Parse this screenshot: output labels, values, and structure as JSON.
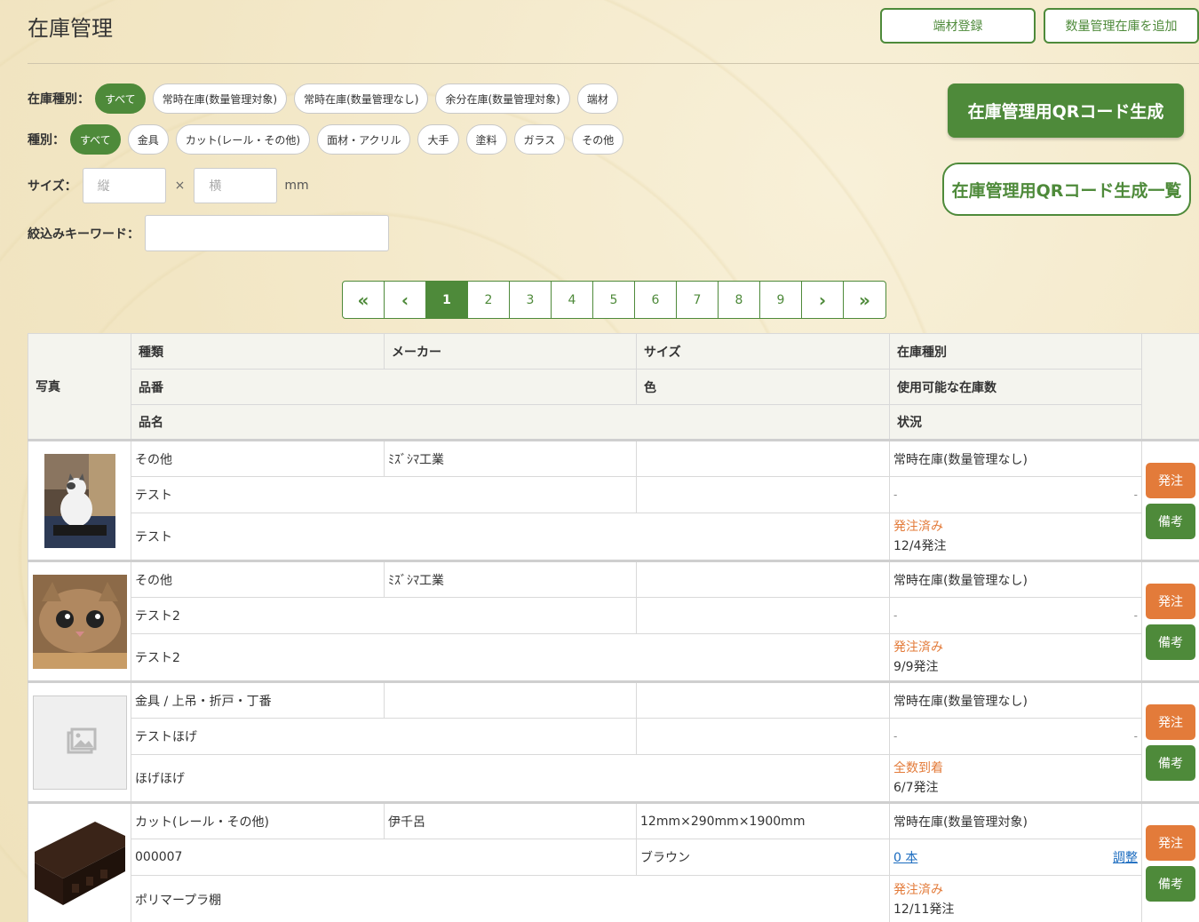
{
  "header": {
    "title": "在庫管理",
    "btn_scrap": "端材登録",
    "btn_add_qty": "数量管理在庫を追加"
  },
  "filters": {
    "stock_type_label": "在庫種別：",
    "stock_types": [
      "すべて",
      "常時在庫(数量管理対象)",
      "常時在庫(数量管理なし)",
      "余分在庫(数量管理対象)",
      "端材"
    ],
    "kind_label": "種別：",
    "kinds": [
      "すべて",
      "金具",
      "カット(レール・その他)",
      "面材・アクリル",
      "大手",
      "塗料",
      "ガラス",
      "その他"
    ],
    "size_label": "サイズ：",
    "size_h_placeholder": "縦",
    "size_times": "×",
    "size_w_placeholder": "横",
    "size_unit": "mm",
    "keyword_label": "絞込みキーワード："
  },
  "qr": {
    "generate": "在庫管理用QRコード生成",
    "list": "在庫管理用QRコード生成一覧"
  },
  "pagination": [
    "«",
    "‹",
    "1",
    "2",
    "3",
    "4",
    "5",
    "6",
    "7",
    "8",
    "9",
    "›",
    "»"
  ],
  "table": {
    "headers": {
      "photo": "写真",
      "kind": "種類",
      "maker": "メーカー",
      "size": "サイズ",
      "stock_type": "在庫種別",
      "part_no": "品番",
      "color": "色",
      "available": "使用可能な在庫数",
      "name": "品名",
      "status": "状況"
    },
    "rows": [
      {
        "kind": "その他",
        "maker": "ﾐｽﾞｼﾏ工業",
        "size": "",
        "stock_type": "常時在庫(数量管理なし)",
        "part_no": "テスト",
        "color": "",
        "available": "-",
        "available_right": "-",
        "name": "テスト",
        "status": "発注済み",
        "status_date": "12/4発注",
        "order": "発注",
        "note": "備考"
      },
      {
        "kind": "その他",
        "maker": "ﾐｽﾞｼﾏ工業",
        "size": "",
        "stock_type": "常時在庫(数量管理なし)",
        "part_no": "テスト2",
        "color": "",
        "available": "-",
        "available_right": "-",
        "name": "テスト2",
        "status": "発注済み",
        "status_date": "9/9発注",
        "order": "発注",
        "note": "備考"
      },
      {
        "kind": "金具 / 上吊・折戸・丁番",
        "maker": "",
        "size": "",
        "stock_type": "常時在庫(数量管理なし)",
        "part_no": "テストほげ",
        "color": "",
        "available": "-",
        "available_right": "-",
        "name": "ほげほげ",
        "status": "全数到着",
        "status_date": "6/7発注",
        "order": "発注",
        "note": "備考"
      },
      {
        "kind": "カット(レール・その他)",
        "maker": "伊千呂",
        "size": "12mm×290mm×1900mm",
        "stock_type": "常時在庫(数量管理対象)",
        "part_no": "000007",
        "color": "ブラウン",
        "available": "0 本",
        "available_right": "調整",
        "name": "ポリマープラ棚",
        "status": "発注済み",
        "status_date": "12/11発注",
        "order": "発注",
        "note": "備考"
      }
    ]
  },
  "colors": {
    "accent": "#4e8a3a",
    "order": "#e37b3a",
    "link": "#1a6bbf"
  }
}
